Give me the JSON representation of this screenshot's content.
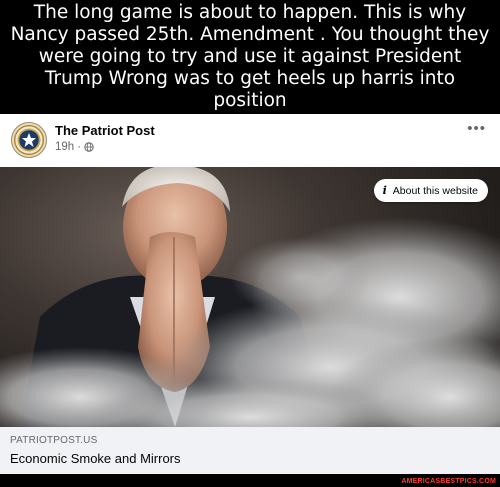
{
  "caption": {
    "text": "The long game is about to happen. This is why Nancy passed  25th. Amendment . You thought they were going to try and use it against President Trump Wrong was to get heels up harris  into position"
  },
  "post": {
    "page_name": "The Patriot Post",
    "time": "19h",
    "separator": "·",
    "audience_icon": "globe-icon",
    "more_icon": "more-options-icon",
    "more_glyph": "•••"
  },
  "image_overlay": {
    "about_label": "About this website",
    "info_glyph": "i"
  },
  "link_preview": {
    "domain": "PATRIOTPOST.US",
    "title": "Economic Smoke and Mirrors"
  },
  "watermark": "AMERICASBESTPICS.COM",
  "colors": {
    "background": "#000000",
    "card": "#ffffff",
    "link_box": "#f0f2f5",
    "watermark": "#ff3b2f"
  }
}
